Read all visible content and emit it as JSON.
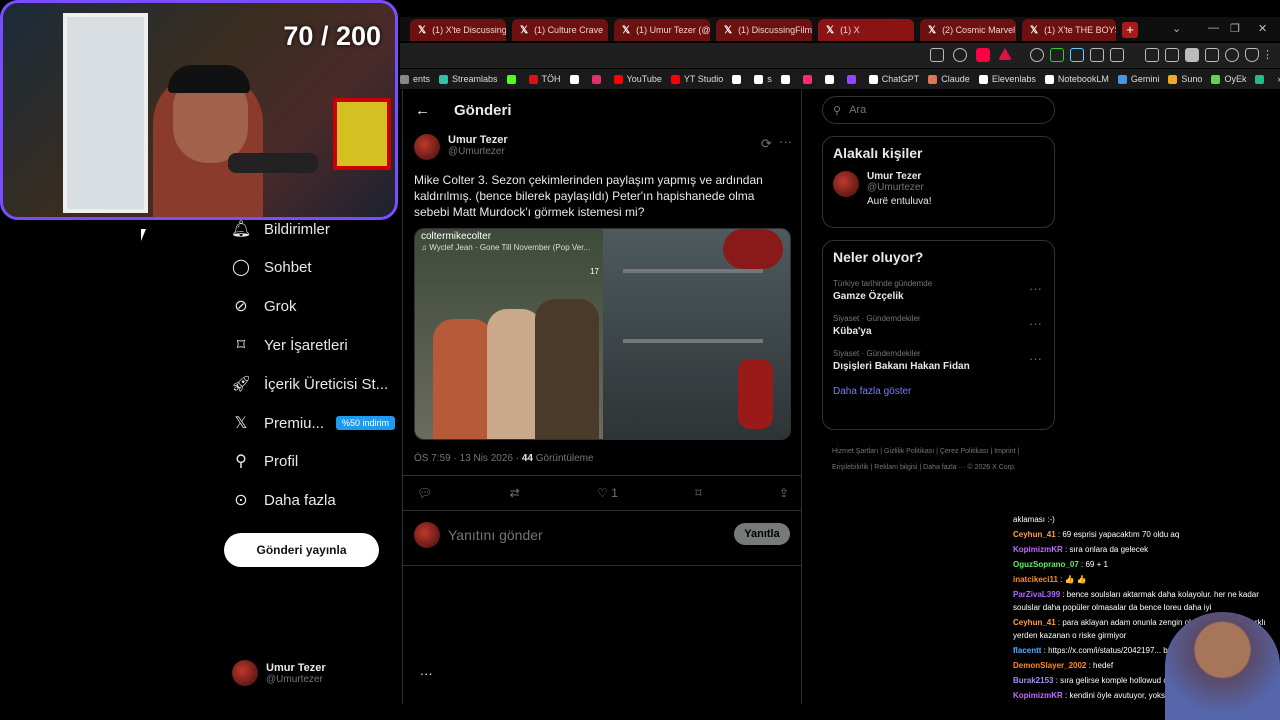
{
  "overlay": {
    "counter": "70 / 200"
  },
  "browser": {
    "tabs": [
      {
        "label": "(1) X'te Discussing"
      },
      {
        "label": "(1) Culture Crave"
      },
      {
        "label": "(1) Umur Tezer (@"
      },
      {
        "label": "(1) DiscussingFilm"
      },
      {
        "label": "(1) X"
      },
      {
        "label": "(2) Cosmic Marvel"
      },
      {
        "label": "(1) X'te THE BOYS"
      }
    ],
    "new_tab": "+",
    "bookmarks": [
      {
        "label": "ents",
        "color": "#888888"
      },
      {
        "label": "Streamlabs",
        "color": "#31c3a2"
      },
      {
        "label": "",
        "color": "#53fc18"
      },
      {
        "label": "TÖH",
        "color": "#d11"
      },
      {
        "label": "",
        "color": "#ffffff"
      },
      {
        "label": "",
        "color": "#e1306c"
      },
      {
        "label": "YouTube",
        "color": "#ff0000"
      },
      {
        "label": "YT Studio",
        "color": "#ff0000"
      },
      {
        "label": "",
        "color": "#ffffff"
      },
      {
        "label": "s",
        "color": "#ffffff"
      },
      {
        "label": "",
        "color": "#ffffff"
      },
      {
        "label": "",
        "color": "#ff2a6d"
      },
      {
        "label": "",
        "color": "#ffffff"
      },
      {
        "label": "",
        "color": "#9146ff"
      },
      {
        "label": "ChatGPT",
        "color": "#ffffff"
      },
      {
        "label": "Claude",
        "color": "#d97757"
      },
      {
        "label": "Elevenlabs",
        "color": "#ffffff"
      },
      {
        "label": "NotebookLM",
        "color": "#ffffff"
      },
      {
        "label": "Gemini",
        "color": "#4796e3"
      },
      {
        "label": "Suno",
        "color": "#f5a623"
      },
      {
        "label": "OyEk",
        "color": "#6ccf52"
      },
      {
        "label": "",
        "color": "#1fbd8a"
      }
    ]
  },
  "sidebar": {
    "items": [
      {
        "label": "Bildirimler",
        "icon": "bell-icon"
      },
      {
        "label": "Sohbet",
        "icon": "chat-icon"
      },
      {
        "label": "Grok",
        "icon": "grok-icon"
      },
      {
        "label": "Yer İşaretleri",
        "icon": "bookmark-icon"
      },
      {
        "label": "İçerik Üreticisi St...",
        "icon": "rocket-icon"
      },
      {
        "label": "Premiu...",
        "icon": "x-logo-icon",
        "badge": "%50 indirim"
      },
      {
        "label": "Profil",
        "icon": "person-icon"
      },
      {
        "label": "Daha fazla",
        "icon": "more-circle-icon"
      }
    ],
    "post_button": "Gönderi yayınla",
    "account": {
      "name": "Umur Tezer",
      "handle": "@Umurtezer",
      "more": "···"
    }
  },
  "main": {
    "title": "Gönderi",
    "back": "←",
    "tweet": {
      "author": "Umur Tezer",
      "handle": "@Umurtezer",
      "text": "Mike Colter 3. Sezon çekimlerinden paylaşım yapmış ve ardından kaldırılmış. (bence bilerek paylaşıldı) Peter'ın hapishanede olma sebebi Matt Murdock'ı görmek istemesi mi?",
      "media": {
        "account": "coltermikecolter",
        "music": "♫ Wyclef Jean · Gone Till November (Pop Ver...",
        "count": "17"
      },
      "time": "ÖS 7:59 · 13 Nis 2026 · ",
      "views": "44",
      "views_label": " Görüntüleme",
      "likes": "1"
    },
    "reply_placeholder": "Yanıtını gönder",
    "reply_button": "Yanıtla"
  },
  "right": {
    "search_placeholder": "Ara",
    "people_title": "Alakalı kişiler",
    "person": {
      "name": "Umur Tezer",
      "handle": "@Umurtezer",
      "bio": "Aurë entuluva!"
    },
    "trends_title": "Neler oluyor?",
    "trends": [
      {
        "context": "Türkiye tarihinde gündemde",
        "topic": "Gamze Özçelik"
      },
      {
        "context": "Siyaset · Gündemdekiler",
        "topic": "Küba'ya"
      },
      {
        "context": "Siyaset · Gündemdekiler",
        "topic": "Dışişleri Bakanı Hakan Fidan"
      }
    ],
    "show_more": "Daha fazla göster",
    "footer": "Hizmet Şartları | Gizlilik Politikası | Çerez Politikası | Imprint | Erişilebilirlik | Reklam bilgisi | Daha fazla ··· © 2026 X Corp."
  },
  "chat": [
    {
      "user": "",
      "text": "aklaması :-)",
      "color": "#ffffff"
    },
    {
      "user": "Ceyhun_41",
      "text": " : 69 esprisi yapacaktım 70 oldu aq",
      "color": "#ff9f40"
    },
    {
      "user": "KopimizmKR",
      "text": " : sıra onlara da gelecek",
      "color": "#c36bff"
    },
    {
      "user": "OguzSoprano_07",
      "text": " : 69 + 1",
      "color": "#5cf25c"
    },
    {
      "user": "inatcikeci11",
      "text": " : 👍 👍",
      "color": "#ff8c1a"
    },
    {
      "user": "ParZivaL399",
      "text": " : bence soulsları aktarmak daha kolayolur. her ne kadar soulslar daha popüler olmasalar da bence loreu daha iyi",
      "color": "#b266ff"
    },
    {
      "user": "Ceyhun_41",
      "text": " : para aklayan adam onunla zengin oluyo ama parayı farklı yerden kazanan o riske girmiyor",
      "color": "#ff9f40"
    },
    {
      "user": "flacentt",
      "text": " : https://x.com/i/status/2042197... bagirtti",
      "color": "#4fb0ff"
    },
    {
      "user": "DemonSlayer_2002",
      "text": " : hedef",
      "color": "#ff8c1a"
    },
    {
      "user": "Burak2153",
      "text": " : sıra gelirse komple hollowud çöp ders",
      "color": "#a78bfa"
    },
    {
      "user": "KopimizmKR",
      "text": " : kendini öyle avutuyor, yoksa hedefsiz",
      "color": "#c36bff"
    }
  ]
}
